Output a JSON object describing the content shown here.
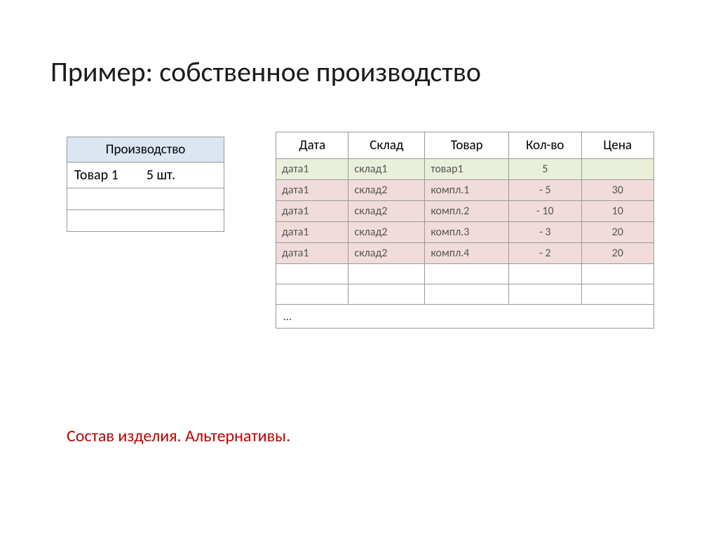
{
  "title": "Пример: собственное производство",
  "left": {
    "header": "Производство",
    "row1": "Товар 1  5 шт."
  },
  "right": {
    "headers": {
      "c1": "Дата",
      "c2": "Склад",
      "c3": "Товар",
      "c4": "Кол-во",
      "c5": "Цена"
    },
    "rows": [
      {
        "c1": "дата1",
        "c2": "склад1",
        "c3": "товар1",
        "c4": "5",
        "c5": ""
      },
      {
        "c1": "дата1",
        "c2": "склад2",
        "c3": "компл.1",
        "c4": "- 5",
        "c5": "30"
      },
      {
        "c1": "дата1",
        "c2": "склад2",
        "c3": "компл.2",
        "c4": "- 10",
        "c5": "10"
      },
      {
        "c1": "дата1",
        "c2": "склад2",
        "c3": "компл.3",
        "c4": "- 3",
        "c5": "20"
      },
      {
        "c1": "дата1",
        "c2": "склад2",
        "c3": "компл.4",
        "c4": "- 2",
        "c5": "20"
      }
    ],
    "ellipsis": "…"
  },
  "footer": "Состав изделия. Альтернативы."
}
